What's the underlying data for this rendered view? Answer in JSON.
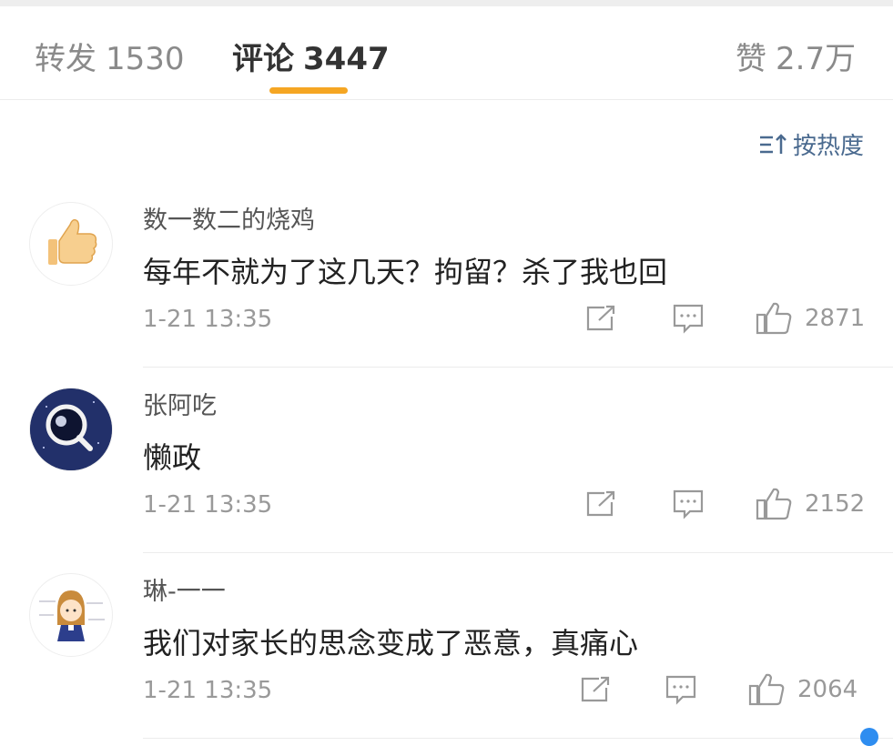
{
  "tabs": [
    {
      "label": "转发",
      "count": "1530"
    },
    {
      "label": "评论",
      "count": "3447"
    },
    {
      "label": "赞",
      "count": "2.7万"
    }
  ],
  "sort": {
    "label": "按热度",
    "icon": "sort-icon"
  },
  "comments": [
    {
      "user": "数一数二的烧鸡",
      "text": "每年不就为了这几天？拘留？杀了我也回",
      "time": "1-21 13:35",
      "likes": "2871",
      "avatar": "thumbs-up-avatar"
    },
    {
      "user": "张阿吃",
      "text": "懒政",
      "time": "1-21 13:35",
      "likes": "2152",
      "avatar": "magnifier-avatar"
    },
    {
      "user": "琳-一一",
      "text": "我们对家长的思念变成了恶意，真痛心",
      "time": "1-21 13:35",
      "likes": "2064",
      "avatar": "cartoon-girl-avatar"
    }
  ],
  "colors": {
    "accent": "#f5a623",
    "sort_text": "#4a6a8f",
    "scroll_dot": "#2e8df0"
  }
}
